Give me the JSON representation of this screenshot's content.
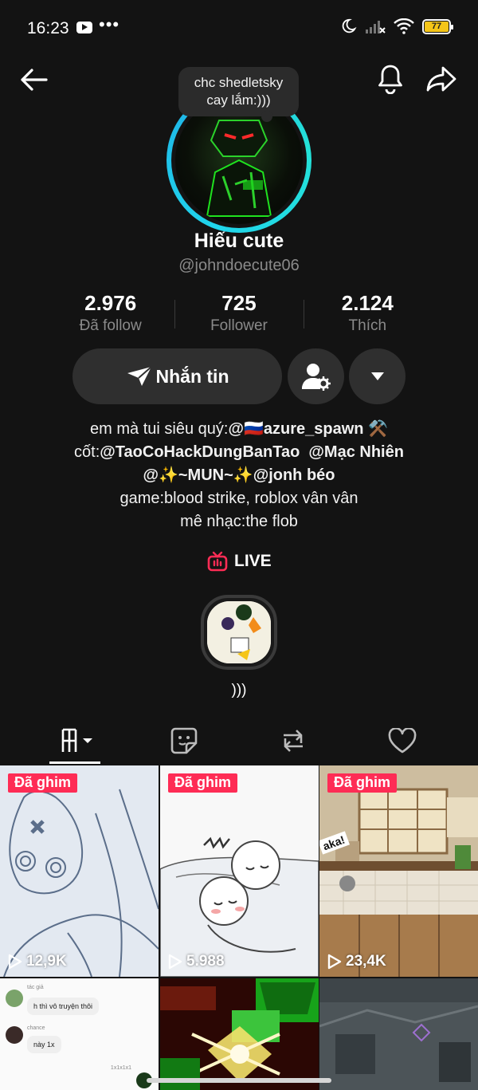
{
  "status_bar": {
    "time": "16:23",
    "dots": "•••",
    "battery": "77"
  },
  "bubble": {
    "line1": "chc shedletsky",
    "line2": "cay lắm:)))"
  },
  "profile": {
    "display_name": "Hiếu cute",
    "username": "@johndoecute06"
  },
  "stats": [
    {
      "value": "2.976",
      "label": "Đã follow"
    },
    {
      "value": "725",
      "label": "Follower"
    },
    {
      "value": "2.124",
      "label": "Thích"
    }
  ],
  "actions": {
    "message_label": "Nhắn tin"
  },
  "bio": {
    "line1_prefix": "em mà tui siêu quý:",
    "line1_mention": "@🇷🇺azure_spawn",
    "line1_suffix": " ⚒️",
    "line2_prefix": "cốt:",
    "line2_mention1": "@TaoCoHackDungBanTao",
    "line2_mention2": "@Mạc Nhiên",
    "line3_mention1": "@✨~MUN~✨",
    "line3_mention2": "@jonh béo",
    "line4": "game:blood strike, roblox vân vân",
    "line5": "mê nhạc:the flob"
  },
  "live_label": "LIVE",
  "highlight": {
    "label": ")))"
  },
  "videos": [
    {
      "pinned": "Đã ghim",
      "views": "12,9K"
    },
    {
      "pinned": "Đã ghim",
      "views": "5.988"
    },
    {
      "pinned": "Đã ghim",
      "views": "23,4K",
      "overlay_text": "aka!"
    }
  ],
  "chat_preview": {
    "author_label": "tác giả",
    "author_msg": "h thì vô truyện thôi",
    "user_label": "chance",
    "user_msg": "này 1x",
    "footer": "1x1x1x1"
  },
  "colors": {
    "accent": "#fe2c55",
    "ring": "#20d5ec",
    "background": "#131313",
    "button": "#2f2f2f"
  }
}
